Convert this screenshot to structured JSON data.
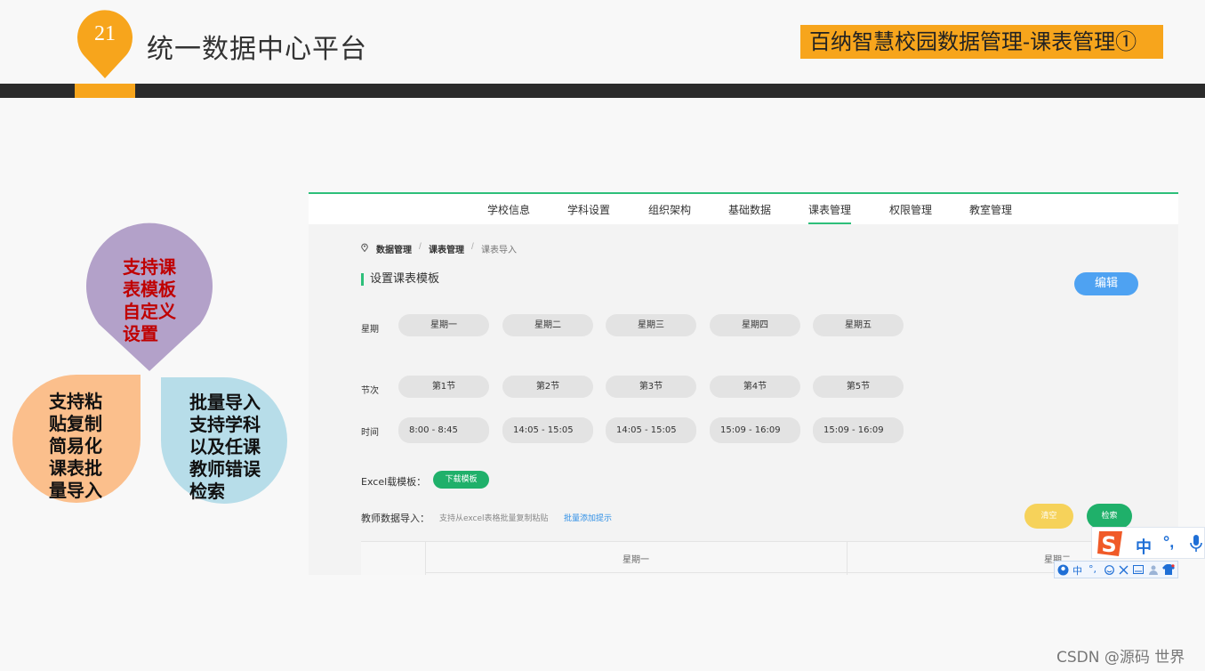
{
  "slide": {
    "page_number": "21",
    "title": "统一数据中心平台",
    "topic": "百纳智慧校园数据管理-课表管理①",
    "accent_color": "#f7a51c",
    "bar_color": "#2b2b2b"
  },
  "features": {
    "purple": {
      "text": "支持课\n表模板\n自定义\n设置",
      "color": "#b3a1c9"
    },
    "orange": {
      "text": "支持粘\n贴复制\n简易化\n课表批\n量导入",
      "color": "#fbbf8c"
    },
    "blue": {
      "text": "批量导入\n支持学科\n以及任课\n教师错误\n检索",
      "color": "#b7dde9"
    }
  },
  "app": {
    "nav": [
      "学校信息",
      "学科设置",
      "组织架构",
      "基础数据",
      "课表管理",
      "权限管理",
      "教室管理"
    ],
    "nav_active_index": 4,
    "breadcrumb": [
      "数据管理",
      "课表管理",
      "课表导入"
    ],
    "breadcrumb_separator": "/",
    "section_title": "设置课表模板",
    "edit_label": "编辑",
    "weekday_label": "星期",
    "weekdays": [
      "星期一",
      "星期二",
      "星期三",
      "星期四",
      "星期五"
    ],
    "period_label": "节次",
    "periods": [
      "第1节",
      "第2节",
      "第3节",
      "第4节",
      "第5节"
    ],
    "time_label": "时间",
    "times": [
      "8:00  -  8:45",
      "14:05  -  15:05",
      "14:05  -  15:05",
      "15:09  -  16:09",
      "15:09  -  16:09"
    ],
    "excel_label": "Excel载模板：",
    "download_label": "下载模板",
    "import_label": "教师数据导入：",
    "import_hint": "支持从excel表格批量复制粘贴",
    "import_link": "批量添加提示",
    "clear_label": "清空",
    "search_label": "检索",
    "table_days": [
      "星期一",
      "星期二"
    ],
    "brand_green": "#2dbf7a",
    "button_blue": "#4ea2f2"
  },
  "ime": {
    "zh": "中",
    "punc": "°,",
    "mini_zh": "中",
    "mini_punc": "°,"
  },
  "watermark": "CSDN @源码 世界"
}
